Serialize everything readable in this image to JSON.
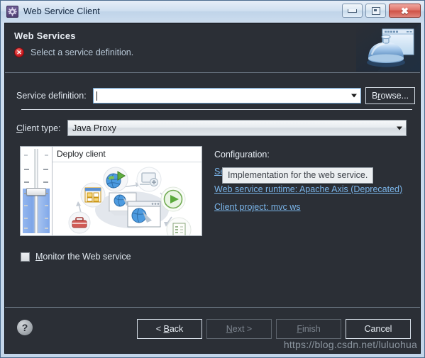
{
  "window": {
    "title": "Web Service Client",
    "icon": "gear-icon",
    "controls": {
      "minimize": "minimize-icon",
      "maximize": "maximize-icon",
      "close": "close-icon"
    }
  },
  "banner": {
    "title": "Web Services",
    "status_icon": "error-icon",
    "status_glyph": "✕",
    "message": "Select a service definition.",
    "art": "web-service-bell-icon"
  },
  "form": {
    "service_definition": {
      "label": "Service definition:",
      "value": "",
      "placeholder": "",
      "browse_label": "Browse...",
      "browse_mnemonic": "r"
    },
    "tooltip": "Implementation for the web service.",
    "client_type": {
      "label": "Client type:",
      "mnemonic": "C",
      "value": "Java Proxy",
      "options": [
        "Java Proxy"
      ]
    },
    "monitor": {
      "label": "Monitor the Web service",
      "mnemonic": "M",
      "checked": false
    }
  },
  "illustration": {
    "slider_title": "Deploy client",
    "slider_value_percent": 53
  },
  "configuration": {
    "title": "Configuration:",
    "links": [
      "Server runtime: Tomcat v8.0 Server",
      "Web service runtime: Apache Axis (Deprecated)",
      "Client project: mvc ws"
    ]
  },
  "footer": {
    "help_icon": "help-icon",
    "help_glyph": "?",
    "buttons": [
      {
        "label": "< Back",
        "enabled": true
      },
      {
        "label": "Next >",
        "enabled": false
      },
      {
        "label": "Finish",
        "enabled": false
      },
      {
        "label": "Cancel",
        "enabled": true
      }
    ],
    "watermark": "https://blog.csdn.net/luluohua"
  },
  "colors": {
    "dialog_bg": "#2b2f36",
    "link": "#7ab4e8",
    "error": "#cf1f24",
    "title_bar": "#cfdff0"
  }
}
